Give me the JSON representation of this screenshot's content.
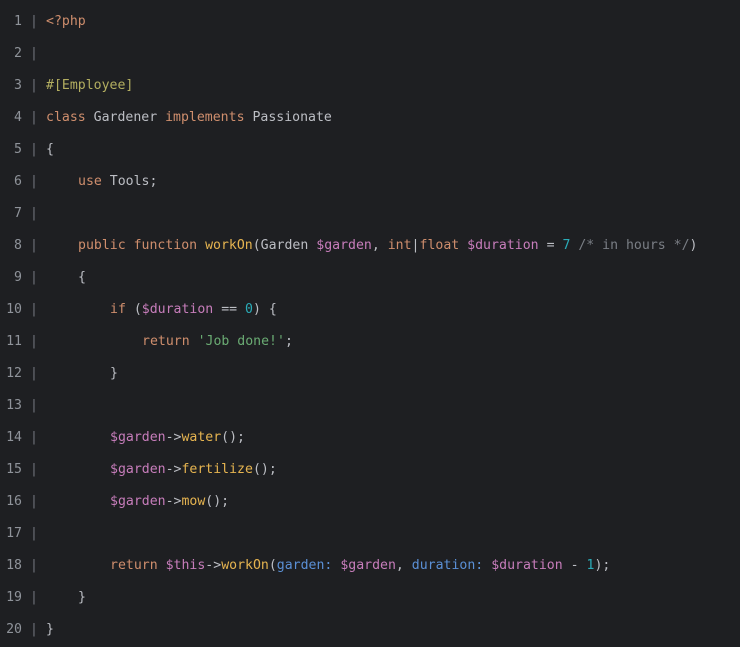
{
  "colors": {
    "background": "#1e1f22",
    "line_number": "#8f939a",
    "separator": "#6f737a",
    "default": "#bcbec4",
    "keyword": "#cf8e6d",
    "variable": "#c77dbb",
    "function": "#e6b450",
    "string": "#6aab73",
    "number": "#2aacb8",
    "comment": "#7a7e85",
    "attribute": "#b3ae60",
    "named_argument": "#5b90d6"
  },
  "separator_char": "|",
  "lines": [
    {
      "num": "1",
      "indent": 0,
      "tokens": [
        {
          "t": "<?php",
          "c": "keyword"
        }
      ]
    },
    {
      "num": "2",
      "indent": 0,
      "tokens": []
    },
    {
      "num": "3",
      "indent": 0,
      "tokens": [
        {
          "t": "#[Employee]",
          "c": "attribute"
        }
      ]
    },
    {
      "num": "4",
      "indent": 0,
      "tokens": [
        {
          "t": "class",
          "c": "keyword"
        },
        {
          "t": " Gardener ",
          "c": "default"
        },
        {
          "t": "implements",
          "c": "keyword"
        },
        {
          "t": " Passionate",
          "c": "default"
        }
      ]
    },
    {
      "num": "5",
      "indent": 0,
      "tokens": [
        {
          "t": "{",
          "c": "default"
        }
      ]
    },
    {
      "num": "6",
      "indent": 1,
      "tokens": [
        {
          "t": "use",
          "c": "keyword"
        },
        {
          "t": " Tools;",
          "c": "default"
        }
      ]
    },
    {
      "num": "7",
      "indent": 0,
      "tokens": []
    },
    {
      "num": "8",
      "indent": 1,
      "tokens": [
        {
          "t": "public",
          "c": "keyword"
        },
        {
          "t": " ",
          "c": "default"
        },
        {
          "t": "function",
          "c": "keyword"
        },
        {
          "t": " ",
          "c": "default"
        },
        {
          "t": "workOn",
          "c": "function"
        },
        {
          "t": "(Garden ",
          "c": "default"
        },
        {
          "t": "$garden",
          "c": "variable"
        },
        {
          "t": ", ",
          "c": "default"
        },
        {
          "t": "int",
          "c": "keyword"
        },
        {
          "t": "|",
          "c": "default"
        },
        {
          "t": "float",
          "c": "keyword"
        },
        {
          "t": " ",
          "c": "default"
        },
        {
          "t": "$duration",
          "c": "variable"
        },
        {
          "t": " = ",
          "c": "default"
        },
        {
          "t": "7",
          "c": "number"
        },
        {
          "t": " ",
          "c": "default"
        },
        {
          "t": "/* in hours */",
          "c": "comment"
        },
        {
          "t": ")",
          "c": "default"
        }
      ]
    },
    {
      "num": "9",
      "indent": 1,
      "tokens": [
        {
          "t": "{",
          "c": "default"
        }
      ]
    },
    {
      "num": "10",
      "indent": 2,
      "tokens": [
        {
          "t": "if",
          "c": "keyword"
        },
        {
          "t": " (",
          "c": "default"
        },
        {
          "t": "$duration",
          "c": "variable"
        },
        {
          "t": " == ",
          "c": "default"
        },
        {
          "t": "0",
          "c": "number"
        },
        {
          "t": ") {",
          "c": "default"
        }
      ]
    },
    {
      "num": "11",
      "indent": 3,
      "tokens": [
        {
          "t": "return",
          "c": "keyword"
        },
        {
          "t": " ",
          "c": "default"
        },
        {
          "t": "'Job done!'",
          "c": "string"
        },
        {
          "t": ";",
          "c": "default"
        }
      ]
    },
    {
      "num": "12",
      "indent": 2,
      "tokens": [
        {
          "t": "}",
          "c": "default"
        }
      ]
    },
    {
      "num": "13",
      "indent": 0,
      "tokens": []
    },
    {
      "num": "14",
      "indent": 2,
      "tokens": [
        {
          "t": "$garden",
          "c": "variable"
        },
        {
          "t": "->",
          "c": "default"
        },
        {
          "t": "water",
          "c": "function"
        },
        {
          "t": "();",
          "c": "default"
        }
      ]
    },
    {
      "num": "15",
      "indent": 2,
      "tokens": [
        {
          "t": "$garden",
          "c": "variable"
        },
        {
          "t": "->",
          "c": "default"
        },
        {
          "t": "fertilize",
          "c": "function"
        },
        {
          "t": "();",
          "c": "default"
        }
      ]
    },
    {
      "num": "16",
      "indent": 2,
      "tokens": [
        {
          "t": "$garden",
          "c": "variable"
        },
        {
          "t": "->",
          "c": "default"
        },
        {
          "t": "mow",
          "c": "function"
        },
        {
          "t": "();",
          "c": "default"
        }
      ]
    },
    {
      "num": "17",
      "indent": 0,
      "tokens": []
    },
    {
      "num": "18",
      "indent": 2,
      "tokens": [
        {
          "t": "return",
          "c": "keyword"
        },
        {
          "t": " ",
          "c": "default"
        },
        {
          "t": "$this",
          "c": "variable"
        },
        {
          "t": "->",
          "c": "default"
        },
        {
          "t": "workOn",
          "c": "function"
        },
        {
          "t": "(",
          "c": "default"
        },
        {
          "t": "garden:",
          "c": "named_argument"
        },
        {
          "t": " ",
          "c": "default"
        },
        {
          "t": "$garden",
          "c": "variable"
        },
        {
          "t": ", ",
          "c": "default"
        },
        {
          "t": "duration:",
          "c": "named_argument"
        },
        {
          "t": " ",
          "c": "default"
        },
        {
          "t": "$duration",
          "c": "variable"
        },
        {
          "t": " - ",
          "c": "default"
        },
        {
          "t": "1",
          "c": "number"
        },
        {
          "t": ");",
          "c": "default"
        }
      ]
    },
    {
      "num": "19",
      "indent": 1,
      "tokens": [
        {
          "t": "}",
          "c": "default"
        }
      ]
    },
    {
      "num": "20",
      "indent": 0,
      "tokens": [
        {
          "t": "}",
          "c": "default"
        }
      ]
    }
  ]
}
